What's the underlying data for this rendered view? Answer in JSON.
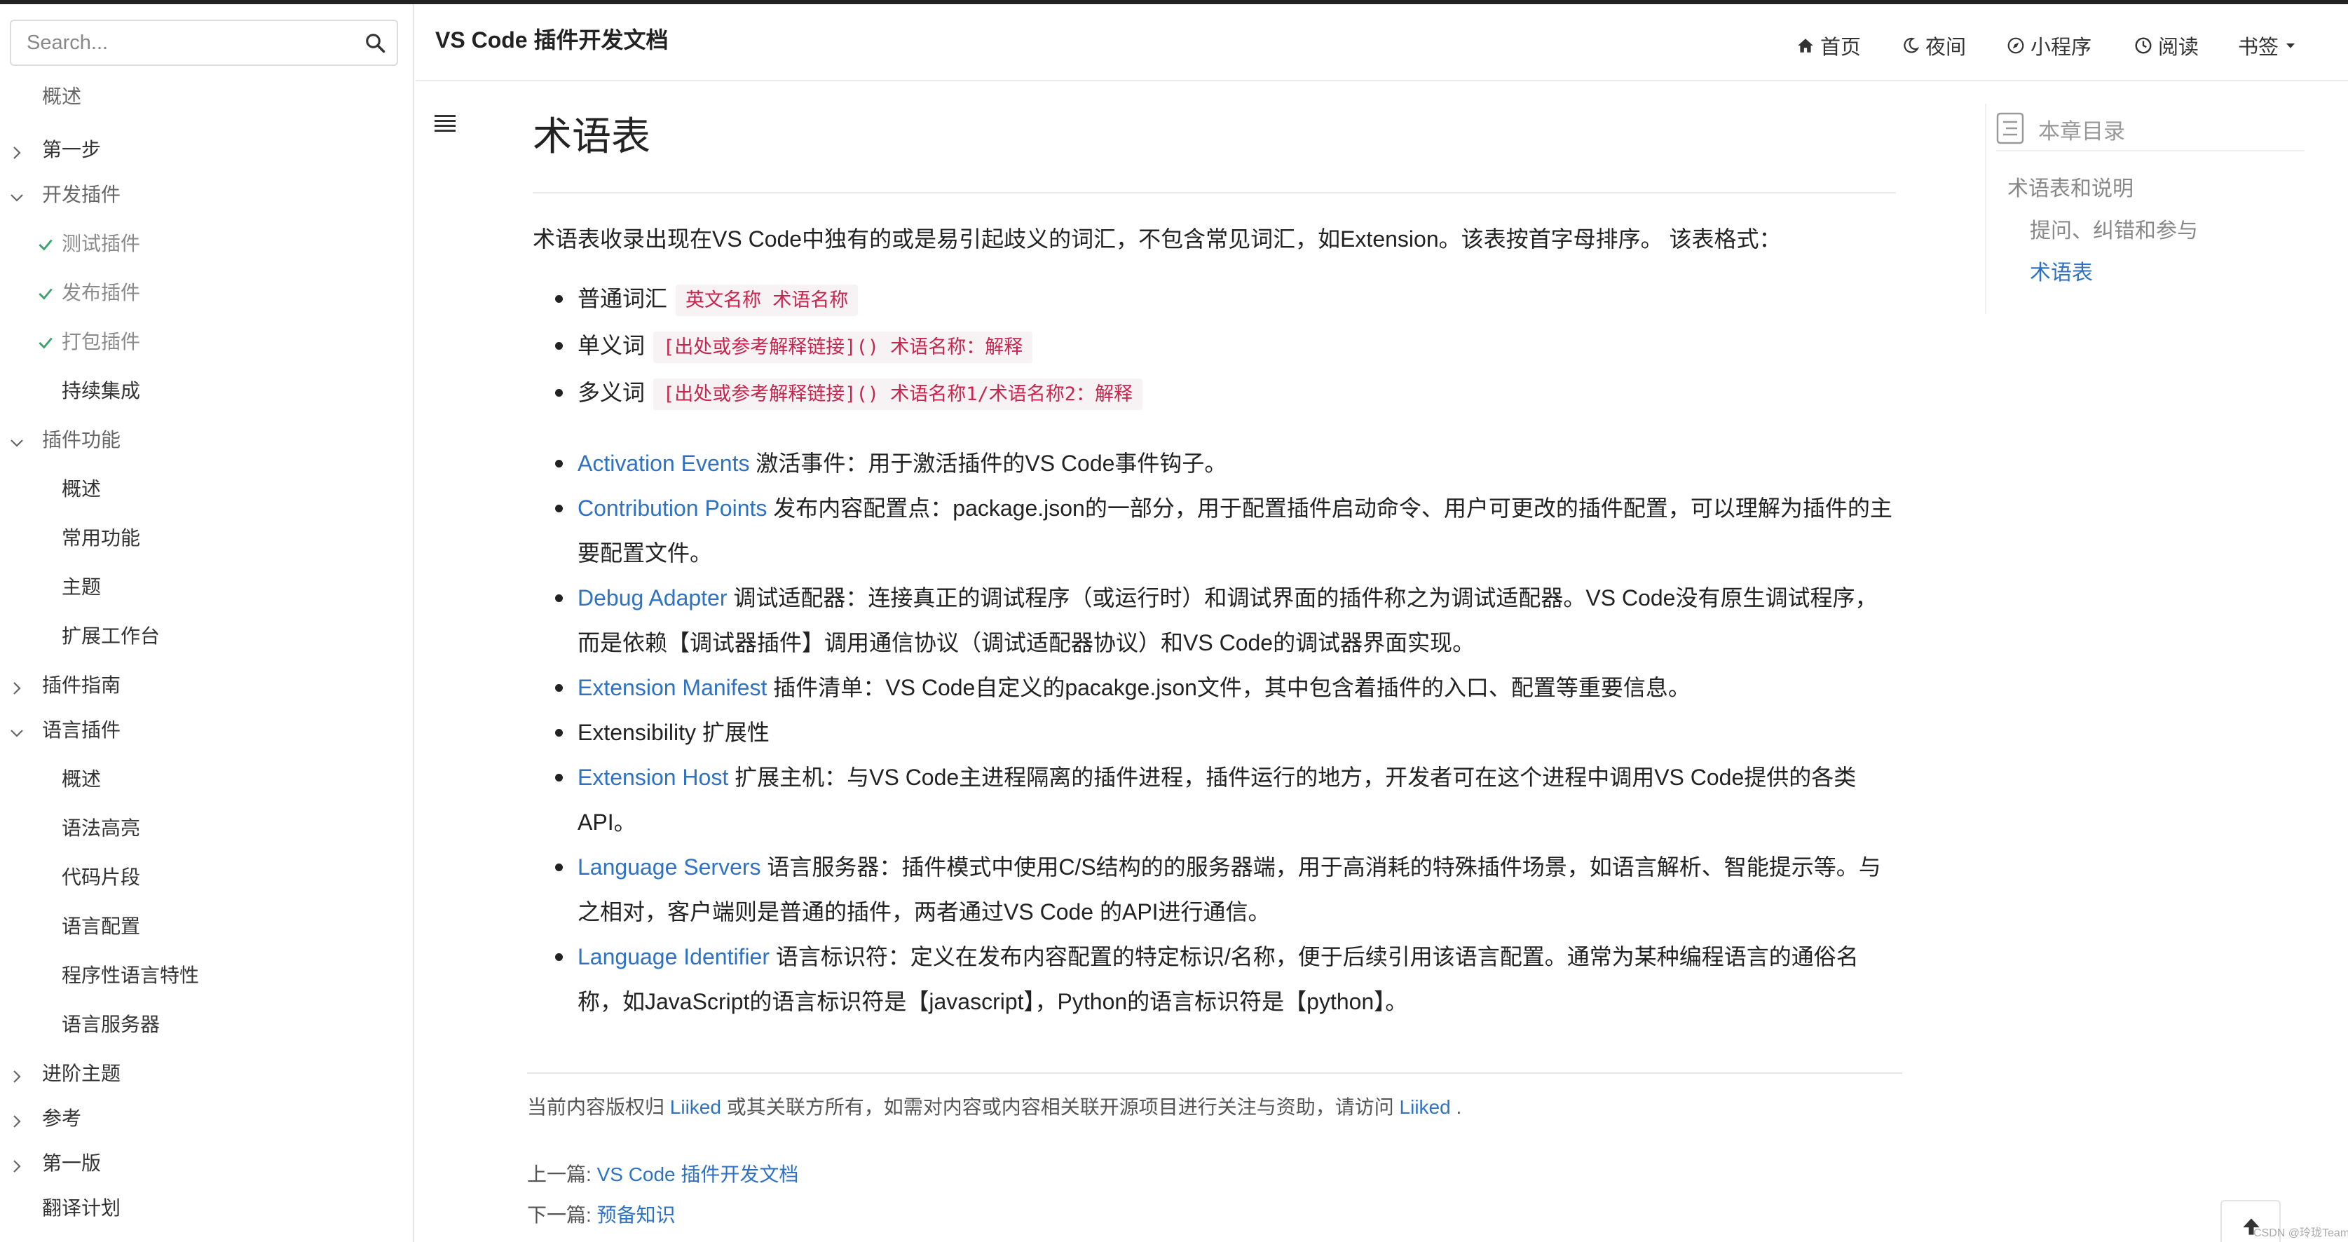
{
  "header": {
    "book_title": "VS Code 插件开发文档",
    "nav": [
      {
        "label": "首页",
        "icon": "home-icon"
      },
      {
        "label": "夜间",
        "icon": "moon-icon"
      },
      {
        "label": "小程序",
        "icon": "compass-icon"
      },
      {
        "label": "阅读",
        "icon": "clock-icon"
      },
      {
        "label": "书签",
        "icon": "caret-down-icon"
      }
    ]
  },
  "search": {
    "placeholder": "Search..."
  },
  "sidebar": {
    "items": [
      {
        "label": "概述"
      },
      {
        "label": "第一步"
      },
      {
        "label": "开发插件"
      },
      {
        "label": "测试插件"
      },
      {
        "label": "发布插件"
      },
      {
        "label": "打包插件"
      },
      {
        "label": "持续集成"
      },
      {
        "label": "插件功能"
      },
      {
        "label": "概述"
      },
      {
        "label": "常用功能"
      },
      {
        "label": "主题"
      },
      {
        "label": "扩展工作台"
      },
      {
        "label": "插件指南"
      },
      {
        "label": "语言插件"
      },
      {
        "label": "概述"
      },
      {
        "label": "语法高亮"
      },
      {
        "label": "代码片段"
      },
      {
        "label": "语言配置"
      },
      {
        "label": "程序性语言特性"
      },
      {
        "label": "语言服务器"
      },
      {
        "label": "进阶主题"
      },
      {
        "label": "参考"
      },
      {
        "label": "第一版"
      },
      {
        "label": "翻译计划"
      }
    ]
  },
  "content": {
    "title": "术语表",
    "intro": "术语表收录出现在VS Code中独有的或是易引起歧义的词汇，不包含常见词汇，如Extension。该表按首字母排序。 该表格式：",
    "formats": [
      {
        "label": "普通词汇",
        "code": "英文名称 术语名称"
      },
      {
        "label": "单义词",
        "code": "[出处或参考解释链接]() 术语名称：解释"
      },
      {
        "label": "多义词",
        "code": "[出处或参考解释链接]() 术语名称1/术语名称2：解释"
      }
    ],
    "terms": [
      {
        "link": "Activation Events",
        "text": " 激活事件：用于激活插件的VS Code事件钩子。"
      },
      {
        "link": "Contribution Points",
        "text": " 发布内容配置点：package.json的一部分，用于配置插件启动命令、用户可更改的插件配置，可以理解为插件的主",
        "text2": "要配置文件。"
      },
      {
        "link": "Debug Adapter",
        "text": " 调试适配器：连接真正的调试程序（或运行时）和调试界面的插件称之为调试适配器。VS Code没有原生调试程序，",
        "text2": "而是依赖【调试器插件】调用通信协议（调试适配器协议）和VS Code的调试器界面实现。"
      },
      {
        "link": "Extension Manifest",
        "text": " 插件清单：VS Code自定义的pacakge.json文件，其中包含着插件的入口、配置等重要信息。"
      },
      {
        "link": "",
        "text": "Extensibility 扩展性"
      },
      {
        "link": "Extension Host",
        "text": " 扩展主机：与VS Code主进程隔离的插件进程，插件运行的地方，开发者可在这个进程中调用VS Code提供的各类",
        "text2": "API。"
      },
      {
        "link": "Language Servers",
        "text": " 语言服务器：插件模式中使用C/S结构的的服务器端，用于高消耗的特殊插件场景，如语言解析、智能提示等。与",
        "text2": "之相对，客户端则是普通的插件，两者通过VS Code 的API进行通信。"
      },
      {
        "link": "Language Identifier",
        "text": " 语言标识符：定义在发布内容配置的特定标识/名称，便于后续引用该语言配置。通常为某种编程语言的通俗名",
        "text2": "称，如JavaScript的语言标识符是【javascript】，Python的语言标识符是【python】。"
      }
    ]
  },
  "footer": {
    "copyright_prefix": "当前内容版权归 ",
    "owner": "Liiked",
    "copyright_middle": " 或其关联方所有，如需对内容或内容相关联开源项目进行关注与资助，请访问 ",
    "copyright_suffix": " .",
    "prev_label": "上一篇: ",
    "prev_link": "VS Code 插件开发文档",
    "next_label": "下一篇: ",
    "next_link": "预备知识"
  },
  "toc": {
    "title": "本章目录",
    "items": [
      {
        "label": "术语表和说明"
      },
      {
        "label": "提问、纠错和参与"
      },
      {
        "label": "术语表"
      }
    ]
  },
  "watermark": "CSDN @玲珑Team",
  "colors": {
    "link": "#2f72c4",
    "code_text": "#c7254e",
    "check": "#3aa36a"
  }
}
